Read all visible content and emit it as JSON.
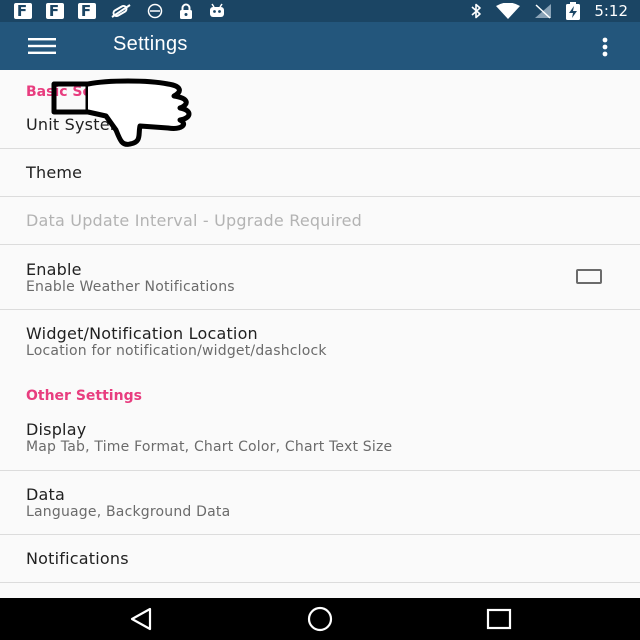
{
  "status_bar": {
    "notification_icons": [
      "facebook-icon",
      "facebook-icon",
      "facebook-icon",
      "no-pills-icon",
      "alarm-off-icon",
      "lock-icon",
      "android-debug-icon"
    ],
    "fb_letter": "F",
    "system_icons": [
      "bluetooth-icon",
      "wifi-icon",
      "no-signal-icon",
      "battery-charging-icon"
    ],
    "time": "5:12"
  },
  "app_bar": {
    "title": "Settings",
    "nav_icon": "hamburger-menu-icon",
    "overflow_icon": "more-vert-icon"
  },
  "sections": [
    {
      "heading": "Basic Settings",
      "items": [
        {
          "title": "Unit System"
        },
        {
          "title": "Theme"
        },
        {
          "title": "Data Update Interval - Upgrade Required",
          "disabled": true
        },
        {
          "title": "Enable",
          "subtitle": "Enable Weather Notifications",
          "checkbox": false
        },
        {
          "title": "Widget/Notification Location",
          "subtitle": "Location for notification/widget/dashclock"
        }
      ]
    },
    {
      "heading": "Other Settings",
      "items": [
        {
          "title": "Display",
          "subtitle": "Map Tab, Time Format, Chart Color, Chart Text Size"
        },
        {
          "title": "Data",
          "subtitle": "Language, Background Data"
        },
        {
          "title": "Notifications"
        }
      ]
    }
  ],
  "overlay": {
    "icon": "thumbs-down-icon"
  },
  "nav_bar": {
    "icons": [
      "back-icon",
      "home-icon",
      "recents-icon"
    ]
  },
  "colors": {
    "status_bar": "#1b4564",
    "app_bar": "#23567c",
    "accent": "#e83d7f",
    "background": "#fafafa",
    "nav_bar": "#000000"
  }
}
